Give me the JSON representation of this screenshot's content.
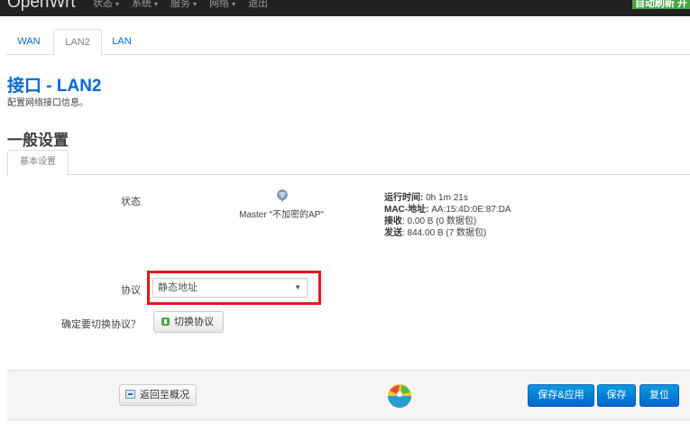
{
  "header": {
    "brand": "OpenWrt",
    "menu": [
      {
        "label": "状态",
        "caret": "▾"
      },
      {
        "label": "系统",
        "caret": "▾"
      },
      {
        "label": "服务",
        "caret": "▾"
      },
      {
        "label": "网络",
        "caret": "▾"
      },
      {
        "label": "退出",
        "caret": ""
      }
    ],
    "refresh_badge": "自动刷新 开",
    "badge_color": "#46a546"
  },
  "tabs": [
    {
      "label": "WAN",
      "active": false
    },
    {
      "label": "LAN2",
      "active": true
    },
    {
      "label": "LAN",
      "active": false
    }
  ],
  "page": {
    "title": "接口 - LAN2",
    "description": "配置网络接口信息。",
    "section_title": "一般设置",
    "subtab": "基本设置"
  },
  "status": {
    "label": "状态",
    "icon": "wifi-icon",
    "ssid": "Master \"不加密的AP\"",
    "uptime_label": "运行时间:",
    "uptime_value": " 0h 1m 21s",
    "mac_label": "MAC-地址:",
    "mac_value": " AA:15:4D:0E:87:DA",
    "rx_label": "接收",
    "rx_value": ": 0.00 B (0 数据包)",
    "tx_label": "发送",
    "tx_value": ": 844.00 B (7 数据包)"
  },
  "protocol": {
    "label": "协议",
    "selected": "静态地址",
    "highlight_color": "#e8131f"
  },
  "switch": {
    "label": "确定要切换协议？",
    "button": "切换协议"
  },
  "footer": {
    "back_button": "返回至概况",
    "save_apply": "保存&应用",
    "save": "保存",
    "reset": "复位",
    "primary_color": "#0064cd"
  }
}
